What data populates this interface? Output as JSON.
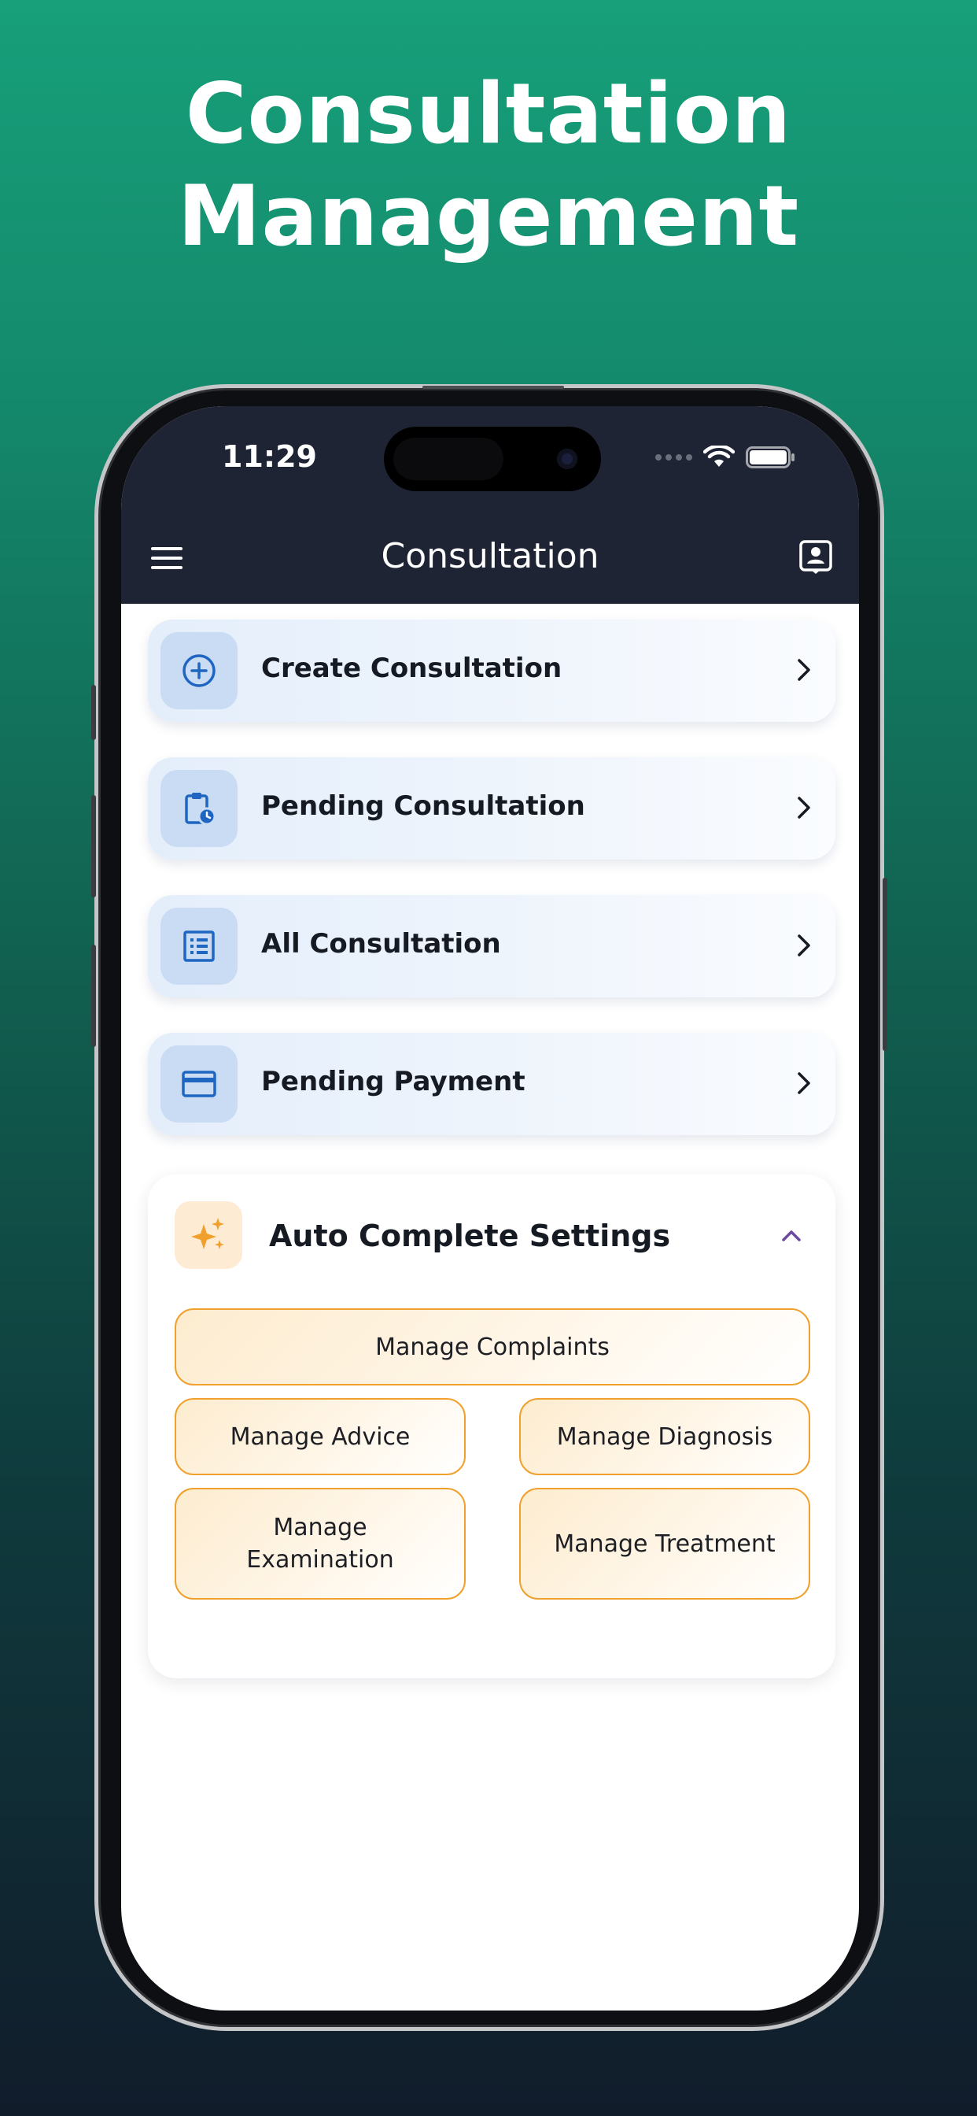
{
  "promo": {
    "title_line1": "Consultation",
    "title_line2": "Management"
  },
  "status_bar": {
    "time": "11:29",
    "icons": [
      "signal-dots-icon",
      "wifi-icon",
      "battery-icon"
    ]
  },
  "nav": {
    "title": "Consultation",
    "left_icon": "hamburger-menu-icon",
    "right_icon": "profile-card-icon"
  },
  "menu": {
    "items": [
      {
        "label": "Create Consultation",
        "icon": "plus-circle-icon"
      },
      {
        "label": "Pending Consultation",
        "icon": "clipboard-clock-icon"
      },
      {
        "label": "All Consultation",
        "icon": "list-icon"
      },
      {
        "label": "Pending Payment",
        "icon": "credit-card-icon"
      }
    ]
  },
  "settings": {
    "title": "Auto Complete Settings",
    "icon": "sparkles-icon",
    "expanded": true,
    "buttons": {
      "complaints": "Manage Complaints",
      "advice": "Manage Advice",
      "diagnosis": "Manage Diagnosis",
      "examination": "Manage Examination",
      "treatment": "Manage Treatment"
    }
  },
  "colors": {
    "nav_background": "#1e2433",
    "accent_blue": "#1f66c2",
    "accent_orange": "#f0a02c",
    "chevron_up": "#6b4aa0",
    "background_top": "#17a07a",
    "background_bottom": "#111c2b"
  }
}
